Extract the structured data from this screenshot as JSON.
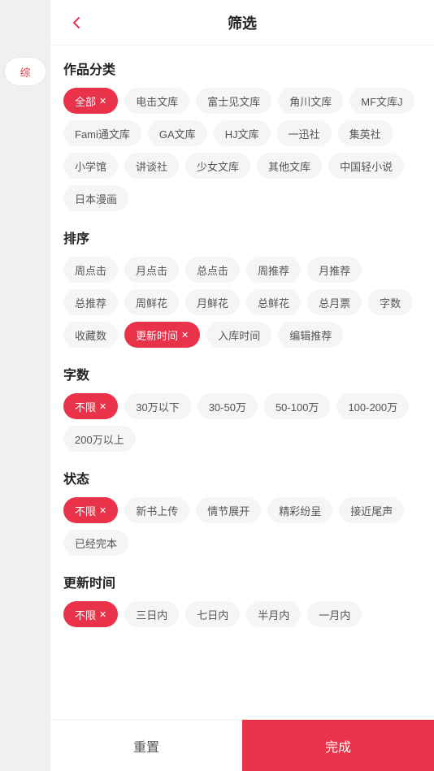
{
  "header": {
    "title": "筛选",
    "back_icon": "‹"
  },
  "sidebar": {
    "tabs": [
      {
        "label": "综",
        "active": true
      }
    ]
  },
  "sections": {
    "category": {
      "title": "作品分类",
      "tags": [
        {
          "label": "全部",
          "active": true,
          "has_close": true
        },
        {
          "label": "电击文库",
          "active": false
        },
        {
          "label": "富士见文库",
          "active": false
        },
        {
          "label": "角川文库",
          "active": false
        },
        {
          "label": "MF文库J",
          "active": false
        },
        {
          "label": "Fami通文库",
          "active": false
        },
        {
          "label": "GA文库",
          "active": false
        },
        {
          "label": "HJ文库",
          "active": false
        },
        {
          "label": "一迅社",
          "active": false
        },
        {
          "label": "集英社",
          "active": false
        },
        {
          "label": "小学馆",
          "active": false
        },
        {
          "label": "讲谈社",
          "active": false
        },
        {
          "label": "少女文库",
          "active": false
        },
        {
          "label": "其他文库",
          "active": false
        },
        {
          "label": "中国轻小说",
          "active": false
        },
        {
          "label": "日本漫画",
          "active": false
        }
      ]
    },
    "sort": {
      "title": "排序",
      "tags": [
        {
          "label": "周点击",
          "active": false
        },
        {
          "label": "月点击",
          "active": false
        },
        {
          "label": "总点击",
          "active": false
        },
        {
          "label": "周推荐",
          "active": false
        },
        {
          "label": "月推荐",
          "active": false
        },
        {
          "label": "总推荐",
          "active": false
        },
        {
          "label": "周鲜花",
          "active": false
        },
        {
          "label": "月鲜花",
          "active": false
        },
        {
          "label": "总鲜花",
          "active": false
        },
        {
          "label": "总月票",
          "active": false
        },
        {
          "label": "字数",
          "active": false
        },
        {
          "label": "收藏数",
          "active": false
        },
        {
          "label": "更新时间",
          "active": true,
          "has_close": true
        },
        {
          "label": "入库时间",
          "active": false
        },
        {
          "label": "编辑推荐",
          "active": false
        }
      ]
    },
    "wordcount": {
      "title": "字数",
      "tags": [
        {
          "label": "不限",
          "active": true,
          "has_close": true
        },
        {
          "label": "30万以下",
          "active": false
        },
        {
          "label": "30-50万",
          "active": false
        },
        {
          "label": "50-100万",
          "active": false
        },
        {
          "label": "100-200万",
          "active": false
        },
        {
          "label": "200万以上",
          "active": false
        }
      ]
    },
    "status": {
      "title": "状态",
      "tags": [
        {
          "label": "不限",
          "active": true,
          "has_close": true
        },
        {
          "label": "新书上传",
          "active": false
        },
        {
          "label": "情节展开",
          "active": false
        },
        {
          "label": "精彩纷呈",
          "active": false
        },
        {
          "label": "接近尾声",
          "active": false
        },
        {
          "label": "已经完本",
          "active": false
        }
      ]
    },
    "update_time": {
      "title": "更新时间",
      "tags": [
        {
          "label": "不限",
          "active": true,
          "has_close": true
        },
        {
          "label": "三日内",
          "active": false
        },
        {
          "label": "七日内",
          "active": false
        },
        {
          "label": "半月内",
          "active": false
        },
        {
          "label": "一月内",
          "active": false
        }
      ]
    }
  },
  "footer": {
    "reset_label": "重置",
    "confirm_label": "完成"
  },
  "colors": {
    "active_bg": "#e8334a",
    "active_text": "#ffffff"
  }
}
